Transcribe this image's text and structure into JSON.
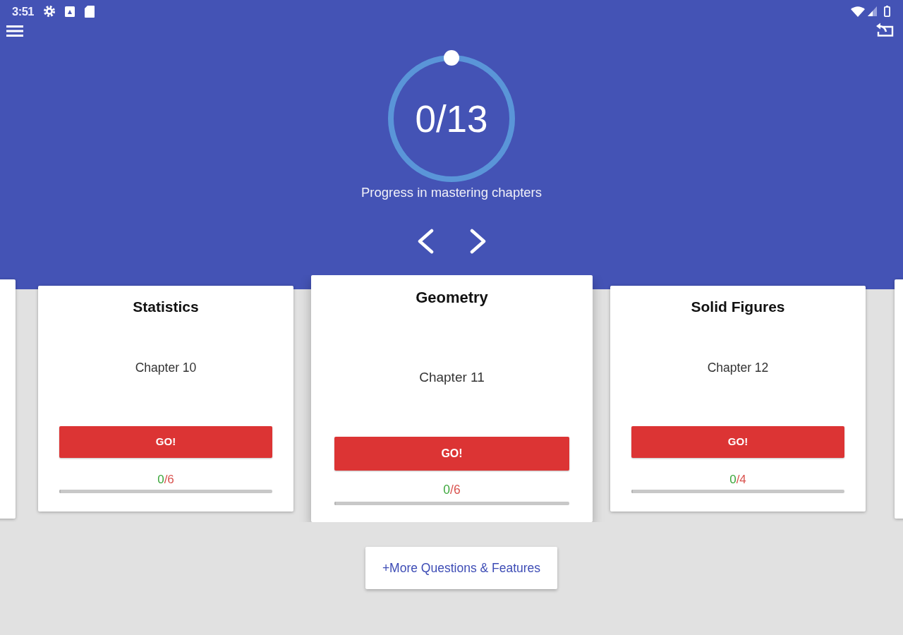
{
  "status_bar": {
    "time": "3:51"
  },
  "progress": {
    "value_text": "0/13",
    "caption": "Progress in mastering chapters"
  },
  "chapters": [
    {
      "title": "Statistics",
      "chapter": "Chapter 10",
      "button": "GO!",
      "done": "0",
      "rest": "/6",
      "level": 0,
      "selected": false
    },
    {
      "title": "Geometry",
      "chapter": "Chapter 11",
      "button": "GO!",
      "done": "0",
      "rest": "/6",
      "level": 0,
      "selected": true
    },
    {
      "title": "Solid Figures",
      "chapter": "Chapter 12",
      "button": "GO!",
      "done": "0",
      "rest": "/4",
      "level": 0,
      "selected": false
    }
  ],
  "more_button": "+More Questions & Features"
}
